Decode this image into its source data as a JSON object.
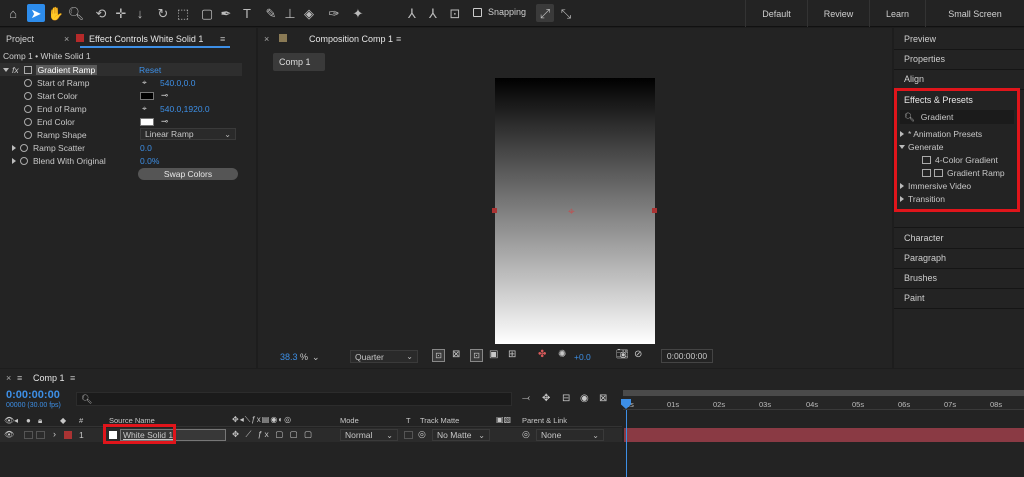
{
  "workspaces": [
    "Default",
    "Review",
    "Learn",
    "Small Screen"
  ],
  "toolbar": {
    "snapping_label": "Snapping"
  },
  "left_panel": {
    "tabs": {
      "project": "Project",
      "effect_controls": "Effect Controls White Solid 1"
    },
    "layer_path": "Comp 1 • White Solid 1",
    "effect": {
      "fx": "fx",
      "name": "Gradient Ramp",
      "reset": "Reset"
    },
    "properties": [
      {
        "label": "Start of Ramp",
        "value": "540.0,0.0"
      },
      {
        "label": "Start Color",
        "value": ""
      },
      {
        "label": "End of Ramp",
        "value": "540.0,1920.0"
      },
      {
        "label": "End Color",
        "value": ""
      },
      {
        "label": "Ramp Shape",
        "value": "Linear Ramp"
      },
      {
        "label": "Ramp Scatter",
        "value": "0.0"
      },
      {
        "label": "Blend With Original",
        "value": "0.0%"
      }
    ],
    "swap_button": "Swap Colors",
    "colors": {
      "start": "#000000",
      "end": "#ffffff"
    }
  },
  "composition": {
    "tab_label": "Composition Comp 1",
    "comp_button": "Comp 1",
    "zoom_value": "38.3",
    "zoom_unit": "%",
    "resolution": "Quarter",
    "exposure": "+0.0",
    "timecode": "0:00:00:00"
  },
  "right_panel": {
    "items_top": [
      "Preview",
      "Properties",
      "Align"
    ],
    "effects_presets": {
      "title": "Effects & Presets",
      "search_value": "Gradient",
      "tree": [
        {
          "label": "* Animation Presets",
          "expanded": false,
          "indent": 0
        },
        {
          "label": "Generate",
          "expanded": true,
          "indent": 0
        },
        {
          "label": "4-Color Gradient",
          "indent": 1
        },
        {
          "label": "Gradient Ramp",
          "indent": 1
        },
        {
          "label": "Immersive Video",
          "expanded": false,
          "indent": 0
        },
        {
          "label": "Transition",
          "expanded": false,
          "indent": 0
        }
      ]
    },
    "items_bottom": [
      "Character",
      "Paragraph",
      "Brushes",
      "Paint"
    ]
  },
  "timeline": {
    "tab_label": "Comp 1",
    "timecode": "0:00:00:00",
    "frames": "00000 (30.00 fps)",
    "search_placeholder": "",
    "columns": {
      "num": "#",
      "source_name": "Source Name",
      "mode": "Mode",
      "t": "T",
      "track_matte": "Track Matte",
      "parent": "Parent & Link"
    },
    "layer": {
      "index": "1",
      "name": "White Solid 1",
      "mode": "Normal",
      "track_matte": "No Matte",
      "parent": "None"
    },
    "ruler": [
      "0s",
      "01s",
      "02s",
      "03s",
      "04s",
      "05s",
      "06s",
      "07s",
      "08s"
    ]
  },
  "accent_colors": {
    "blue": "#3d8fe6",
    "highlight_red": "#e0151b",
    "layer_bar": "#8a3a44"
  }
}
